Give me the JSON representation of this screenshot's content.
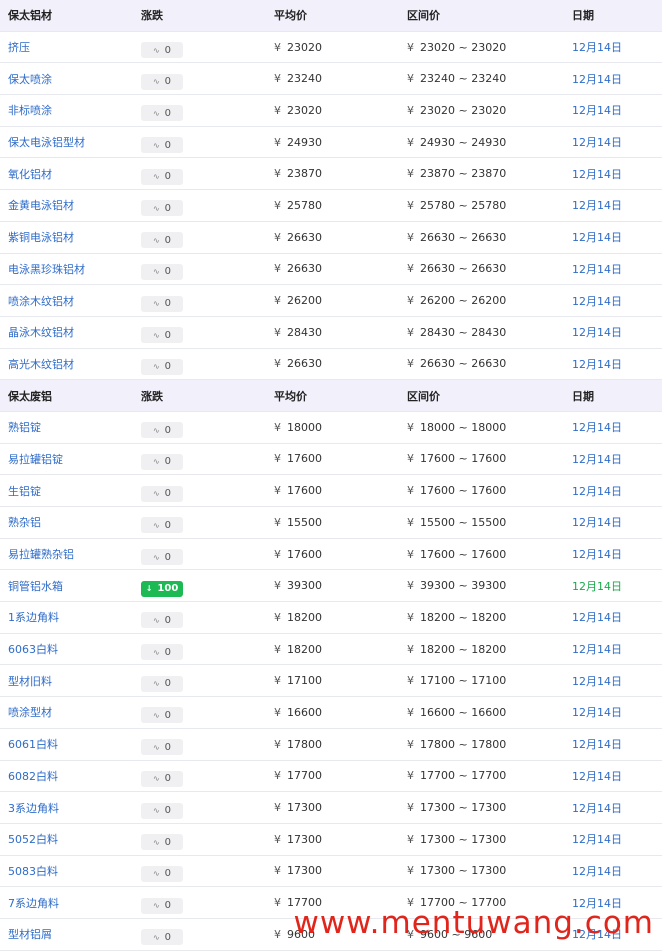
{
  "tables": [
    {
      "headers": [
        "保太铝材",
        "涨跌",
        "平均价",
        "区间价",
        "日期"
      ],
      "rows": [
        {
          "name": "挤压",
          "change": "0",
          "trend": "flat",
          "avg": "23020",
          "range": "23020 ~ 23020",
          "date": "12月14日"
        },
        {
          "name": "保太喷涂",
          "change": "0",
          "trend": "flat",
          "avg": "23240",
          "range": "23240 ~ 23240",
          "date": "12月14日"
        },
        {
          "name": "非标喷涂",
          "change": "0",
          "trend": "flat",
          "avg": "23020",
          "range": "23020 ~ 23020",
          "date": "12月14日"
        },
        {
          "name": "保太电泳铝型材",
          "change": "0",
          "trend": "flat",
          "avg": "24930",
          "range": "24930 ~ 24930",
          "date": "12月14日"
        },
        {
          "name": "氧化铝材",
          "change": "0",
          "trend": "flat",
          "avg": "23870",
          "range": "23870 ~ 23870",
          "date": "12月14日"
        },
        {
          "name": "金黄电泳铝材",
          "change": "0",
          "trend": "flat",
          "avg": "25780",
          "range": "25780 ~ 25780",
          "date": "12月14日"
        },
        {
          "name": "紫铜电泳铝材",
          "change": "0",
          "trend": "flat",
          "avg": "26630",
          "range": "26630 ~ 26630",
          "date": "12月14日"
        },
        {
          "name": "电泳黑珍珠铝材",
          "change": "0",
          "trend": "flat",
          "avg": "26630",
          "range": "26630 ~ 26630",
          "date": "12月14日"
        },
        {
          "name": "喷涂木纹铝材",
          "change": "0",
          "trend": "flat",
          "avg": "26200",
          "range": "26200 ~ 26200",
          "date": "12月14日"
        },
        {
          "name": "晶泳木纹铝材",
          "change": "0",
          "trend": "flat",
          "avg": "28430",
          "range": "28430 ~ 28430",
          "date": "12月14日"
        },
        {
          "name": "高光木纹铝材",
          "change": "0",
          "trend": "flat",
          "avg": "26630",
          "range": "26630 ~ 26630",
          "date": "12月14日"
        }
      ]
    },
    {
      "headers": [
        "保太废铝",
        "涨跌",
        "平均价",
        "区间价",
        "日期"
      ],
      "rows": [
        {
          "name": "熟铝锭",
          "change": "0",
          "trend": "flat",
          "avg": "18000",
          "range": "18000 ~ 18000",
          "date": "12月14日"
        },
        {
          "name": "易拉罐铝锭",
          "change": "0",
          "trend": "flat",
          "avg": "17600",
          "range": "17600 ~ 17600",
          "date": "12月14日"
        },
        {
          "name": "生铝锭",
          "change": "0",
          "trend": "flat",
          "avg": "17600",
          "range": "17600 ~ 17600",
          "date": "12月14日"
        },
        {
          "name": "熟杂铝",
          "change": "0",
          "trend": "flat",
          "avg": "15500",
          "range": "15500 ~ 15500",
          "date": "12月14日"
        },
        {
          "name": "易拉罐熟杂铝",
          "change": "0",
          "trend": "flat",
          "avg": "17600",
          "range": "17600 ~ 17600",
          "date": "12月14日"
        },
        {
          "name": "铜管铝水箱",
          "change": "100",
          "trend": "up",
          "avg": "39300",
          "range": "39300 ~ 39300",
          "date": "12月14日"
        },
        {
          "name": "1系边角料",
          "change": "0",
          "trend": "flat",
          "avg": "18200",
          "range": "18200 ~ 18200",
          "date": "12月14日"
        },
        {
          "name": "6063白料",
          "change": "0",
          "trend": "flat",
          "avg": "18200",
          "range": "18200 ~ 18200",
          "date": "12月14日"
        },
        {
          "name": "型材旧料",
          "change": "0",
          "trend": "flat",
          "avg": "17100",
          "range": "17100 ~ 17100",
          "date": "12月14日"
        },
        {
          "name": "喷涂型材",
          "change": "0",
          "trend": "flat",
          "avg": "16600",
          "range": "16600 ~ 16600",
          "date": "12月14日"
        },
        {
          "name": "6061白料",
          "change": "0",
          "trend": "flat",
          "avg": "17800",
          "range": "17800 ~ 17800",
          "date": "12月14日"
        },
        {
          "name": "6082白料",
          "change": "0",
          "trend": "flat",
          "avg": "17700",
          "range": "17700 ~ 17700",
          "date": "12月14日"
        },
        {
          "name": "3系边角料",
          "change": "0",
          "trend": "flat",
          "avg": "17300",
          "range": "17300 ~ 17300",
          "date": "12月14日"
        },
        {
          "name": "5052白料",
          "change": "0",
          "trend": "flat",
          "avg": "17300",
          "range": "17300 ~ 17300",
          "date": "12月14日"
        },
        {
          "name": "5083白料",
          "change": "0",
          "trend": "flat",
          "avg": "17300",
          "range": "17300 ~ 17300",
          "date": "12月14日"
        },
        {
          "name": "7系边角料",
          "change": "0",
          "trend": "flat",
          "avg": "17700",
          "range": "17700 ~ 17700",
          "date": "12月14日"
        },
        {
          "name": "型材铝屑",
          "change": "0",
          "trend": "flat",
          "avg": "9600",
          "range": "9600 ~ 9600",
          "date": "12月14日"
        }
      ]
    }
  ],
  "currency_symbol": "¥",
  "flat_symbol": "∿",
  "up_symbol": "↓",
  "watermark": "www.mentuwang.com",
  "colors": {
    "link": "#2f6cc9",
    "up": "#1db954",
    "header_bg": "#f1f0fb",
    "watermark": "#e1251b"
  }
}
